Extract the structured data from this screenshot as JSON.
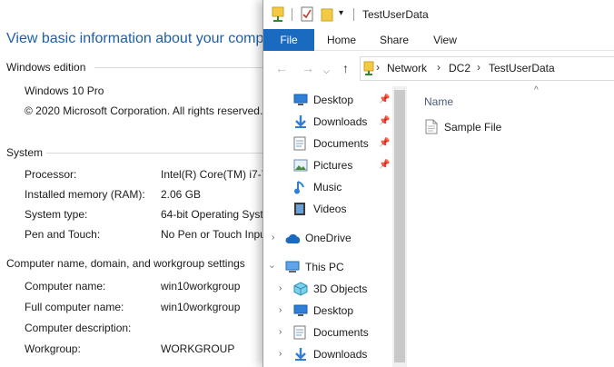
{
  "system": {
    "heading": "View basic information about your comp",
    "windows_edition": {
      "title": "Windows edition",
      "name": "Windows 10 Pro",
      "copyright": "© 2020 Microsoft Corporation. All rights reserved."
    },
    "system_section": {
      "title": "System",
      "rows": [
        {
          "label": "Processor:",
          "value": "Intel(R) Core(TM) i7-7"
        },
        {
          "label": "Installed memory (RAM):",
          "value": "2.06 GB"
        },
        {
          "label": "System type:",
          "value": "64-bit Operating Syst"
        },
        {
          "label": "Pen and Touch:",
          "value": "No Pen or Touch Inpu"
        }
      ]
    },
    "computer_section": {
      "title": "Computer name, domain, and workgroup settings",
      "rows": [
        {
          "label": "Computer name:",
          "value": "win10workgroup"
        },
        {
          "label": "Full computer name:",
          "value": "win10workgroup"
        },
        {
          "label": "Computer description:",
          "value": ""
        },
        {
          "label": "Workgroup:",
          "value": "WORKGROUP"
        }
      ]
    }
  },
  "explorer": {
    "title": "TestUserData",
    "ribbon": {
      "file": "File",
      "home": "Home",
      "share": "Share",
      "view": "View"
    },
    "address": {
      "crumbs": [
        "Network",
        "DC2",
        "TestUserData"
      ]
    },
    "nav": {
      "quick_access": [
        {
          "label": "Desktop",
          "icon": "desktop-icon"
        },
        {
          "label": "Downloads",
          "icon": "downloads-icon"
        },
        {
          "label": "Documents",
          "icon": "documents-icon"
        },
        {
          "label": "Pictures",
          "icon": "pictures-icon"
        },
        {
          "label": "Music",
          "icon": "music-icon"
        },
        {
          "label": "Videos",
          "icon": "videos-icon"
        }
      ],
      "onedrive": "OneDrive",
      "this_pc": "This PC",
      "this_pc_children": [
        {
          "label": "3D Objects",
          "icon": "3d-objects-icon"
        },
        {
          "label": "Desktop",
          "icon": "desktop-icon"
        },
        {
          "label": "Documents",
          "icon": "documents-icon"
        },
        {
          "label": "Downloads",
          "icon": "downloads-icon"
        }
      ]
    },
    "content": {
      "column_name": "Name",
      "files": [
        "Sample File"
      ]
    },
    "colors": {
      "file_tab": "#1a6ac0",
      "heading_blue": "#1e5fa8",
      "folder_yellow": "#f3c945"
    }
  }
}
